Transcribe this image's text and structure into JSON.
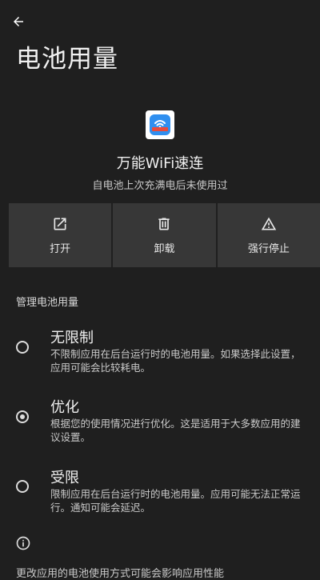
{
  "header": {
    "back_icon": "arrow-left-icon",
    "title": "电池用量"
  },
  "app": {
    "icon": "wifi-app-icon",
    "name": "万能WiFi速连",
    "usage_summary": "自电池上次充满电后未使用过"
  },
  "actions": [
    {
      "label": "打开",
      "icon": "open-external-icon"
    },
    {
      "label": "卸载",
      "icon": "trash-icon"
    },
    {
      "label": "强行停止",
      "icon": "warning-icon"
    }
  ],
  "section": {
    "title": "管理电池用量"
  },
  "options": [
    {
      "title": "无限制",
      "description": "不限制应用在后台运行时的电池用量。如果选择此设置，应用可能会比较耗电。",
      "selected": false
    },
    {
      "title": "优化",
      "description": "根据您的使用情况进行优化。这是适用于大多数应用的建议设置。",
      "selected": true
    },
    {
      "title": "受限",
      "description": "限制应用在后台运行时的电池用量。应用可能无法正常运行。通知可能会延迟。",
      "selected": false
    }
  ],
  "footer": {
    "info_icon": "info-icon",
    "text": "更改应用的电池使用方式可能会影响应用性能"
  },
  "colors": {
    "background": "#1f1f1f",
    "button_bg": "#373737",
    "text_primary": "#f0f0f0",
    "text_secondary": "#c9c9c9"
  }
}
